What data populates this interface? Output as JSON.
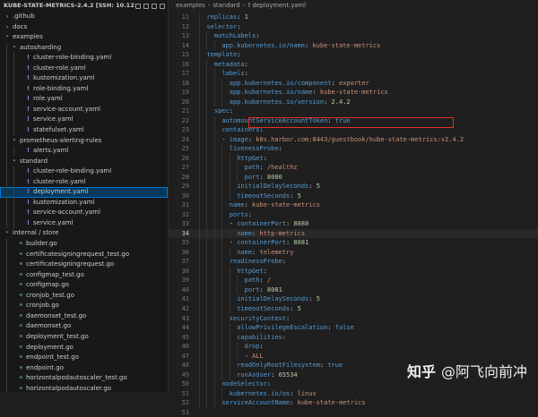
{
  "sidebar": {
    "title": "KUBE-STATE-METRICS-2.4.2 [SSH: 10.121.198....",
    "items": [
      {
        "label": ".github",
        "depth": 0,
        "type": "folder",
        "open": false
      },
      {
        "label": "docs",
        "depth": 0,
        "type": "folder",
        "open": false
      },
      {
        "label": "examples",
        "depth": 0,
        "type": "folder",
        "open": true
      },
      {
        "label": "autosharding",
        "depth": 1,
        "type": "folder",
        "open": true
      },
      {
        "label": "cluster-role-binding.yaml",
        "depth": 2,
        "type": "yaml"
      },
      {
        "label": "cluster-role.yaml",
        "depth": 2,
        "type": "yaml"
      },
      {
        "label": "kustomization.yaml",
        "depth": 2,
        "type": "yaml"
      },
      {
        "label": "role-binding.yaml",
        "depth": 2,
        "type": "yaml"
      },
      {
        "label": "role.yaml",
        "depth": 2,
        "type": "yaml"
      },
      {
        "label": "service-account.yaml",
        "depth": 2,
        "type": "yaml"
      },
      {
        "label": "service.yaml",
        "depth": 2,
        "type": "yaml"
      },
      {
        "label": "statefulset.yaml",
        "depth": 2,
        "type": "yaml"
      },
      {
        "label": "prometheus-alerting-rules",
        "depth": 1,
        "type": "folder",
        "open": true
      },
      {
        "label": "alerts.yaml",
        "depth": 2,
        "type": "yaml"
      },
      {
        "label": "standard",
        "depth": 1,
        "type": "folder",
        "open": true
      },
      {
        "label": "cluster-role-binding.yaml",
        "depth": 2,
        "type": "yaml"
      },
      {
        "label": "cluster-role.yaml",
        "depth": 2,
        "type": "yaml"
      },
      {
        "label": "deployment.yaml",
        "depth": 2,
        "type": "yaml",
        "selected": true
      },
      {
        "label": "kustomization.yaml",
        "depth": 2,
        "type": "yaml"
      },
      {
        "label": "service-account.yaml",
        "depth": 2,
        "type": "yaml"
      },
      {
        "label": "service.yaml",
        "depth": 2,
        "type": "yaml"
      },
      {
        "label": "internal / store",
        "depth": 0,
        "type": "folder",
        "open": true
      },
      {
        "label": "builder.go",
        "depth": 1,
        "type": "go"
      },
      {
        "label": "certificatesigningrequest_test.go",
        "depth": 1,
        "type": "go"
      },
      {
        "label": "certificatesigningrequest.go",
        "depth": 1,
        "type": "go"
      },
      {
        "label": "configmap_test.go",
        "depth": 1,
        "type": "go"
      },
      {
        "label": "configmap.go",
        "depth": 1,
        "type": "go"
      },
      {
        "label": "cronjob_test.go",
        "depth": 1,
        "type": "go"
      },
      {
        "label": "cronjob.go",
        "depth": 1,
        "type": "go"
      },
      {
        "label": "daemonset_test.go",
        "depth": 1,
        "type": "go"
      },
      {
        "label": "daemonset.go",
        "depth": 1,
        "type": "go"
      },
      {
        "label": "deployment_test.go",
        "depth": 1,
        "type": "go"
      },
      {
        "label": "deployment.go",
        "depth": 1,
        "type": "go"
      },
      {
        "label": "endpoint_test.go",
        "depth": 1,
        "type": "go"
      },
      {
        "label": "endpoint.go",
        "depth": 1,
        "type": "go"
      },
      {
        "label": "horizontalpodautoscaler_test.go",
        "depth": 1,
        "type": "go"
      },
      {
        "label": "horizontalpodautoscaler.go",
        "depth": 1,
        "type": "go"
      },
      {
        "label": "ingress_test.go",
        "depth": 1,
        "type": "go"
      }
    ]
  },
  "breadcrumb": [
    "examples",
    "standard",
    "deployment.yaml"
  ],
  "icons": {
    "yaml": "exclamation-yaml-icon",
    "go": "go-file-icon",
    "folder_open": "chevron-down-icon",
    "folder_closed": "chevron-right-icon"
  },
  "editor": {
    "current_line": 34,
    "highlight_line": 24,
    "lines": [
      {
        "n": 11,
        "indent": 2,
        "tokens": [
          {
            "t": "k",
            "s": "replicas"
          },
          {
            "t": "d",
            "s": ": "
          },
          {
            "t": "n",
            "s": "1"
          }
        ]
      },
      {
        "n": 12,
        "indent": 2,
        "tokens": [
          {
            "t": "k",
            "s": "selector"
          },
          {
            "t": "d",
            "s": ":"
          }
        ]
      },
      {
        "n": 13,
        "indent": 4,
        "tokens": [
          {
            "t": "k",
            "s": "matchLabels"
          },
          {
            "t": "d",
            "s": ":"
          }
        ]
      },
      {
        "n": 14,
        "indent": 6,
        "tokens": [
          {
            "t": "k",
            "s": "app.kubernetes.io/name"
          },
          {
            "t": "d",
            "s": ": "
          },
          {
            "t": "v",
            "s": "kube-state-metrics"
          }
        ]
      },
      {
        "n": 15,
        "indent": 2,
        "tokens": [
          {
            "t": "k",
            "s": "template"
          },
          {
            "t": "d",
            "s": ":"
          }
        ]
      },
      {
        "n": 16,
        "indent": 4,
        "tokens": [
          {
            "t": "k",
            "s": "metadata"
          },
          {
            "t": "d",
            "s": ":"
          }
        ]
      },
      {
        "n": 17,
        "indent": 6,
        "tokens": [
          {
            "t": "k",
            "s": "labels"
          },
          {
            "t": "d",
            "s": ":"
          }
        ]
      },
      {
        "n": 18,
        "indent": 8,
        "tokens": [
          {
            "t": "k",
            "s": "app.kubernetes.io/component"
          },
          {
            "t": "d",
            "s": ": "
          },
          {
            "t": "v",
            "s": "exporter"
          }
        ]
      },
      {
        "n": 19,
        "indent": 8,
        "tokens": [
          {
            "t": "k",
            "s": "app.kubernetes.io/name"
          },
          {
            "t": "d",
            "s": ": "
          },
          {
            "t": "v",
            "s": "kube-state-metrics"
          }
        ]
      },
      {
        "n": 20,
        "indent": 8,
        "tokens": [
          {
            "t": "k",
            "s": "app.kubernetes.io/version"
          },
          {
            "t": "d",
            "s": ": "
          },
          {
            "t": "n",
            "s": "2.4.2"
          }
        ]
      },
      {
        "n": 21,
        "indent": 4,
        "tokens": [
          {
            "t": "k",
            "s": "spec"
          },
          {
            "t": "d",
            "s": ":"
          }
        ]
      },
      {
        "n": 22,
        "indent": 6,
        "tokens": [
          {
            "t": "k",
            "s": "automountServiceAccountToken"
          },
          {
            "t": "d",
            "s": ": "
          },
          {
            "t": "b",
            "s": "true"
          }
        ]
      },
      {
        "n": 23,
        "indent": 6,
        "tokens": [
          {
            "t": "k",
            "s": "containers"
          },
          {
            "t": "d",
            "s": ":"
          }
        ]
      },
      {
        "n": 24,
        "indent": 6,
        "tokens": [
          {
            "t": "d",
            "s": "- "
          },
          {
            "t": "k",
            "s": "image"
          },
          {
            "t": "d",
            "s": ": "
          },
          {
            "t": "v",
            "s": "k8s.harbor.com:8443/guestbook/kube-state-metrics:v2.4.2"
          }
        ]
      },
      {
        "n": 25,
        "indent": 8,
        "tokens": [
          {
            "t": "k",
            "s": "livenessProbe"
          },
          {
            "t": "d",
            "s": ":"
          }
        ]
      },
      {
        "n": 26,
        "indent": 10,
        "tokens": [
          {
            "t": "k",
            "s": "httpGet"
          },
          {
            "t": "d",
            "s": ":"
          }
        ]
      },
      {
        "n": 27,
        "indent": 12,
        "tokens": [
          {
            "t": "k",
            "s": "path"
          },
          {
            "t": "d",
            "s": ": "
          },
          {
            "t": "v",
            "s": "/healthz"
          }
        ]
      },
      {
        "n": 28,
        "indent": 12,
        "tokens": [
          {
            "t": "k",
            "s": "port"
          },
          {
            "t": "d",
            "s": ": "
          },
          {
            "t": "n",
            "s": "8080"
          }
        ]
      },
      {
        "n": 29,
        "indent": 10,
        "tokens": [
          {
            "t": "k",
            "s": "initialDelaySeconds"
          },
          {
            "t": "d",
            "s": ": "
          },
          {
            "t": "n",
            "s": "5"
          }
        ]
      },
      {
        "n": 30,
        "indent": 10,
        "tokens": [
          {
            "t": "k",
            "s": "timeoutSeconds"
          },
          {
            "t": "d",
            "s": ": "
          },
          {
            "t": "n",
            "s": "5"
          }
        ]
      },
      {
        "n": 31,
        "indent": 8,
        "tokens": [
          {
            "t": "k",
            "s": "name"
          },
          {
            "t": "d",
            "s": ": "
          },
          {
            "t": "v",
            "s": "kube-state-metrics"
          }
        ]
      },
      {
        "n": 32,
        "indent": 8,
        "tokens": [
          {
            "t": "k",
            "s": "ports"
          },
          {
            "t": "d",
            "s": ":"
          }
        ]
      },
      {
        "n": 33,
        "indent": 8,
        "tokens": [
          {
            "t": "d",
            "s": "- "
          },
          {
            "t": "k",
            "s": "containerPort"
          },
          {
            "t": "d",
            "s": ": "
          },
          {
            "t": "n",
            "s": "8080"
          }
        ]
      },
      {
        "n": 34,
        "indent": 10,
        "tokens": [
          {
            "t": "k",
            "s": "name"
          },
          {
            "t": "d",
            "s": ": "
          },
          {
            "t": "v",
            "s": "http-metrics"
          }
        ]
      },
      {
        "n": 35,
        "indent": 8,
        "tokens": [
          {
            "t": "d",
            "s": "- "
          },
          {
            "t": "k",
            "s": "containerPort"
          },
          {
            "t": "d",
            "s": ": "
          },
          {
            "t": "n",
            "s": "8081"
          }
        ]
      },
      {
        "n": 36,
        "indent": 10,
        "tokens": [
          {
            "t": "k",
            "s": "name"
          },
          {
            "t": "d",
            "s": ": "
          },
          {
            "t": "v",
            "s": "telemetry"
          }
        ]
      },
      {
        "n": 37,
        "indent": 8,
        "tokens": [
          {
            "t": "k",
            "s": "readinessProbe"
          },
          {
            "t": "d",
            "s": ":"
          }
        ]
      },
      {
        "n": 38,
        "indent": 10,
        "tokens": [
          {
            "t": "k",
            "s": "httpGet"
          },
          {
            "t": "d",
            "s": ":"
          }
        ]
      },
      {
        "n": 39,
        "indent": 12,
        "tokens": [
          {
            "t": "k",
            "s": "path"
          },
          {
            "t": "d",
            "s": ": "
          },
          {
            "t": "v",
            "s": "/"
          }
        ]
      },
      {
        "n": 40,
        "indent": 12,
        "tokens": [
          {
            "t": "k",
            "s": "port"
          },
          {
            "t": "d",
            "s": ": "
          },
          {
            "t": "n",
            "s": "8081"
          }
        ]
      },
      {
        "n": 41,
        "indent": 10,
        "tokens": [
          {
            "t": "k",
            "s": "initialDelaySeconds"
          },
          {
            "t": "d",
            "s": ": "
          },
          {
            "t": "n",
            "s": "5"
          }
        ]
      },
      {
        "n": 42,
        "indent": 10,
        "tokens": [
          {
            "t": "k",
            "s": "timeoutSeconds"
          },
          {
            "t": "d",
            "s": ": "
          },
          {
            "t": "n",
            "s": "5"
          }
        ]
      },
      {
        "n": 43,
        "indent": 8,
        "tokens": [
          {
            "t": "k",
            "s": "securityContext"
          },
          {
            "t": "d",
            "s": ":"
          }
        ]
      },
      {
        "n": 44,
        "indent": 10,
        "tokens": [
          {
            "t": "k",
            "s": "allowPrivilegeEscalation"
          },
          {
            "t": "d",
            "s": ": "
          },
          {
            "t": "b",
            "s": "false"
          }
        ]
      },
      {
        "n": 45,
        "indent": 10,
        "tokens": [
          {
            "t": "k",
            "s": "capabilities"
          },
          {
            "t": "d",
            "s": ":"
          }
        ]
      },
      {
        "n": 46,
        "indent": 12,
        "tokens": [
          {
            "t": "k",
            "s": "drop"
          },
          {
            "t": "d",
            "s": ":"
          }
        ]
      },
      {
        "n": 47,
        "indent": 12,
        "tokens": [
          {
            "t": "d",
            "s": "- "
          },
          {
            "t": "v",
            "s": "ALL"
          }
        ]
      },
      {
        "n": 48,
        "indent": 10,
        "tokens": [
          {
            "t": "k",
            "s": "readOnlyRootFilesystem"
          },
          {
            "t": "d",
            "s": ": "
          },
          {
            "t": "b",
            "s": "true"
          }
        ]
      },
      {
        "n": 49,
        "indent": 10,
        "tokens": [
          {
            "t": "k",
            "s": "runAsUser"
          },
          {
            "t": "d",
            "s": ": "
          },
          {
            "t": "n",
            "s": "65534"
          }
        ]
      },
      {
        "n": 50,
        "indent": 6,
        "tokens": [
          {
            "t": "k",
            "s": "nodeSelector"
          },
          {
            "t": "d",
            "s": ":"
          }
        ]
      },
      {
        "n": 51,
        "indent": 8,
        "tokens": [
          {
            "t": "k",
            "s": "kubernetes.io/os"
          },
          {
            "t": "d",
            "s": ": "
          },
          {
            "t": "v",
            "s": "linux"
          }
        ]
      },
      {
        "n": 52,
        "indent": 6,
        "tokens": [
          {
            "t": "k",
            "s": "serviceAccountName"
          },
          {
            "t": "d",
            "s": ": "
          },
          {
            "t": "v",
            "s": "kube-state-metrics"
          }
        ]
      },
      {
        "n": 53,
        "indent": 0,
        "tokens": []
      }
    ]
  },
  "watermark": {
    "brand": "知乎",
    "handle": "@阿飞向前冲"
  }
}
